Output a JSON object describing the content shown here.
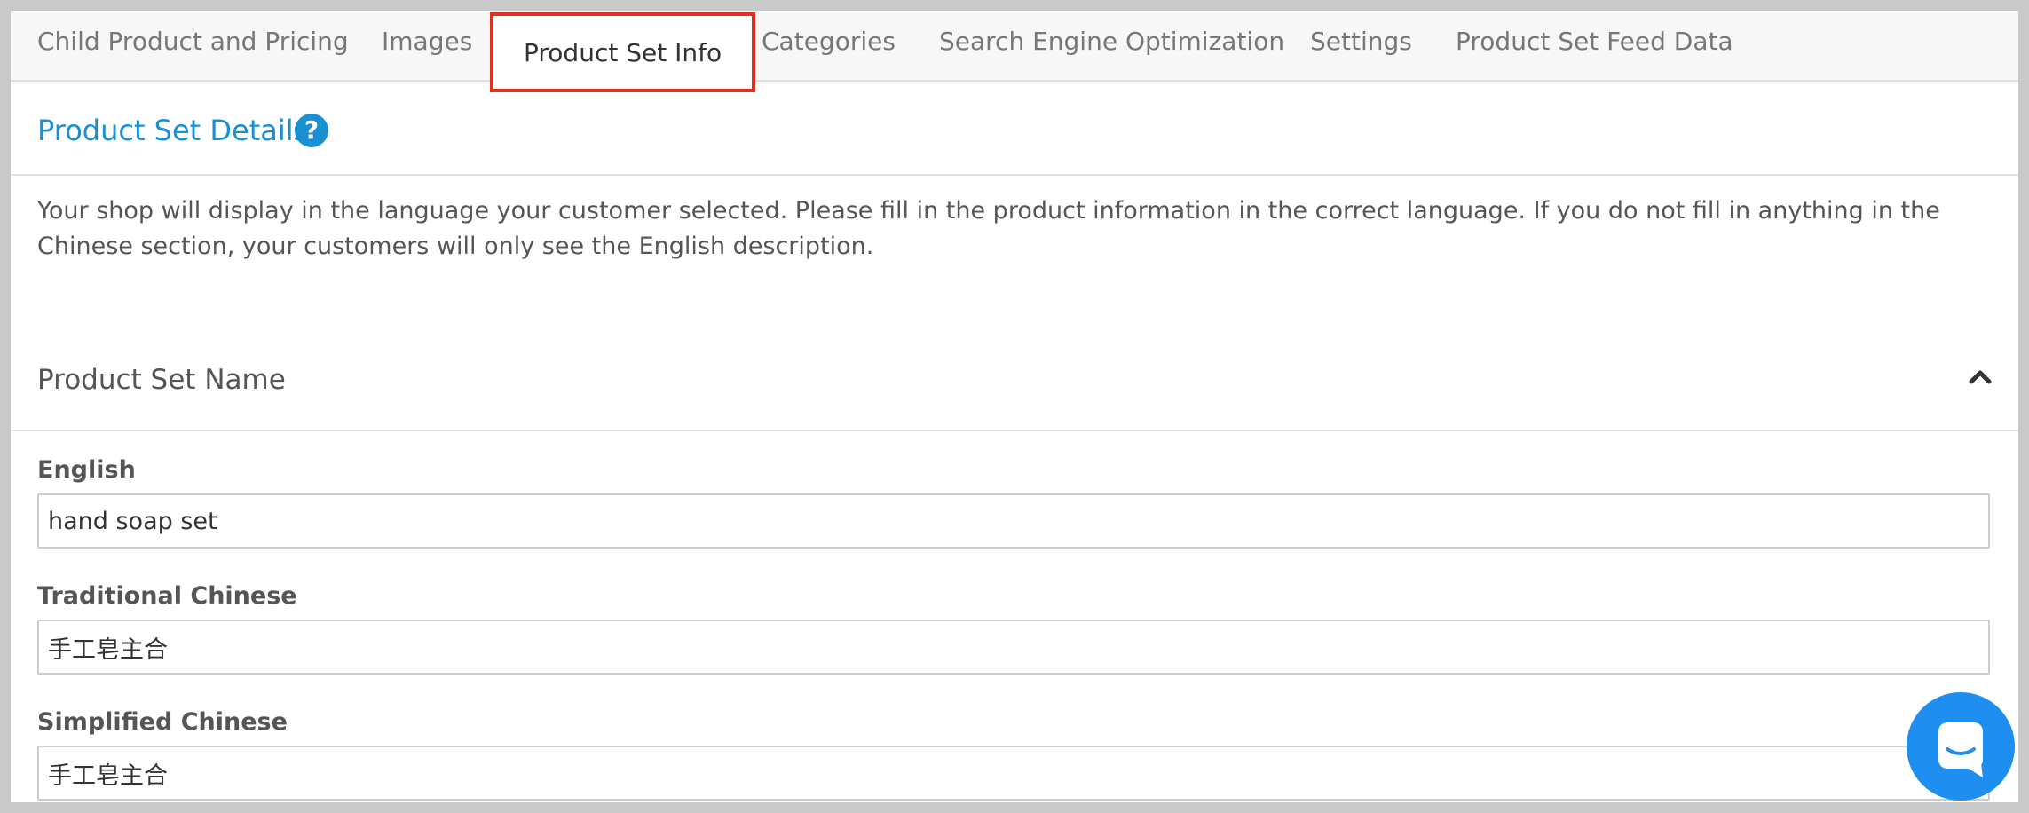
{
  "tabs": [
    {
      "label": "Child Product and Pricing"
    },
    {
      "label": "Images"
    },
    {
      "label": "Product Set Info"
    },
    {
      "label": "Categories"
    },
    {
      "label": "Search Engine Optimization"
    },
    {
      "label": "Settings"
    },
    {
      "label": "Product Set Feed Data"
    }
  ],
  "active_tab": "Product Set Info",
  "details": {
    "title": "Product Set Details",
    "help_icon": "question-circle-icon",
    "notice": "Your shop will display in the language your customer selected. Please fill in the product information in the correct language. If you do not fill in anything in the Chinese section, your customers will only see the English description."
  },
  "name_section": {
    "title": "Product Set Name",
    "collapse_icon": "chevron-up-icon",
    "fields": [
      {
        "label": "English",
        "value": "hand soap set"
      },
      {
        "label": "Traditional Chinese",
        "value": "手工皂主合"
      },
      {
        "label": "Simplified Chinese",
        "value": "手工皂主合"
      }
    ]
  },
  "chat": {
    "icon": "chat-widget-icon"
  },
  "colors": {
    "accent": "#1a8fd1",
    "highlight_border": "#e0301e",
    "chat_button": "#1e8ff0"
  }
}
